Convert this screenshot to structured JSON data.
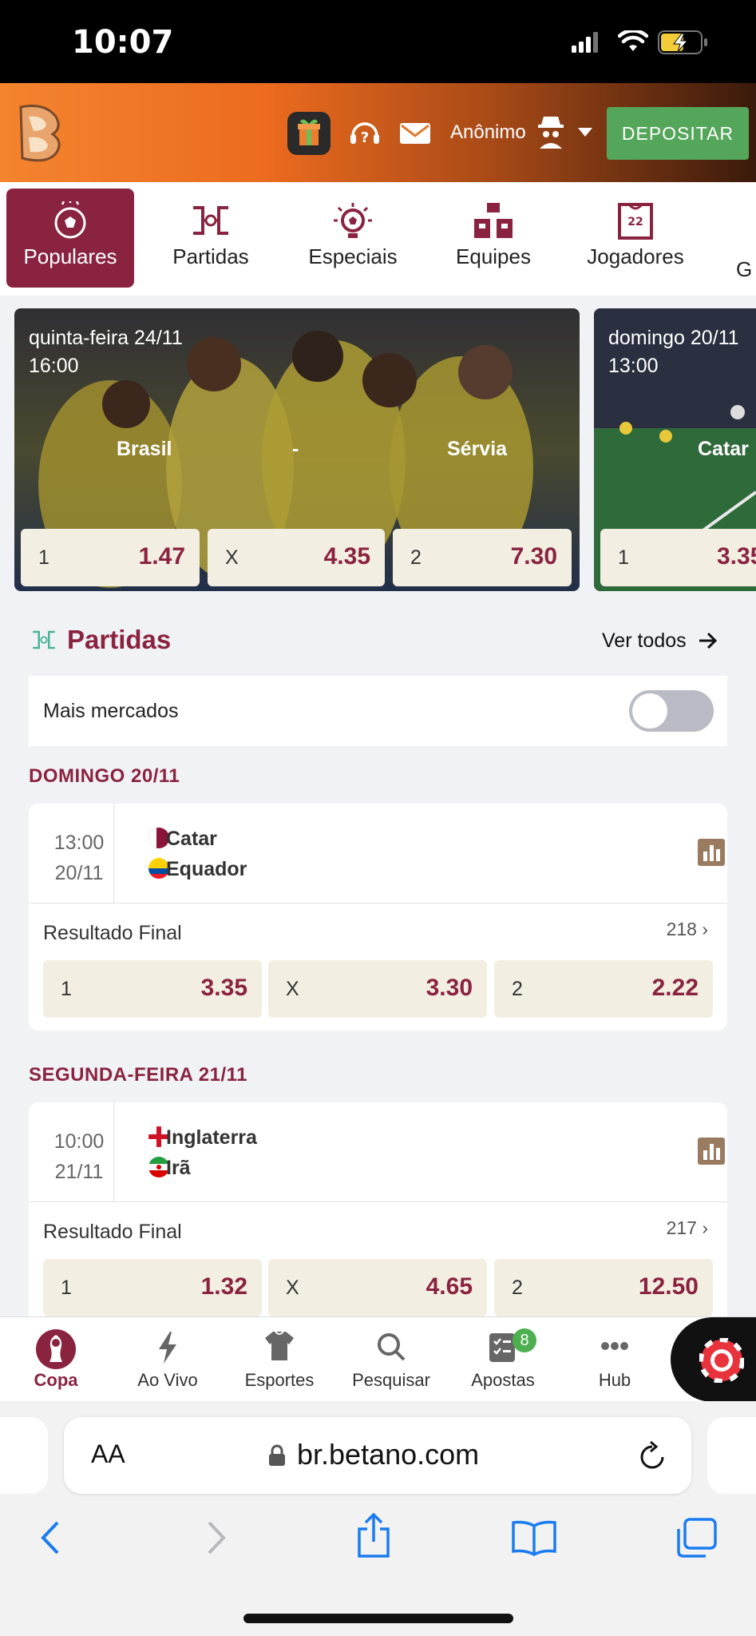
{
  "status_bar": {
    "time": "10:07"
  },
  "header": {
    "user_label": "Anônimo",
    "deposit_label": "DEPOSITAR"
  },
  "tabs": [
    {
      "label": "Populares",
      "icon": "soccer-ball-icon",
      "active": true
    },
    {
      "label": "Partidas",
      "icon": "versus-icon"
    },
    {
      "label": "Especiais",
      "icon": "lightbulb-ball-icon"
    },
    {
      "label": "Equipes",
      "icon": "team-shirts-icon"
    },
    {
      "label": "Jogadores",
      "icon": "player-shirt-icon"
    },
    {
      "label": "G"
    }
  ],
  "hero_cards": [
    {
      "date": "quinta-feira 24/11",
      "time": "16:00",
      "home": "Brasil",
      "separator": "-",
      "away": "Sérvia",
      "odds": [
        {
          "label": "1",
          "value": "1.47"
        },
        {
          "label": "X",
          "value": "4.35"
        },
        {
          "label": "2",
          "value": "7.30"
        }
      ]
    },
    {
      "date": "domingo 20/11",
      "time": "13:00",
      "home": "Catar",
      "odds": [
        {
          "label": "1",
          "value": "3.35"
        }
      ]
    }
  ],
  "partidas": {
    "title": "Partidas",
    "see_all": "Ver todos",
    "more_markets_label": "Mais mercados",
    "more_markets_on": false,
    "groups": [
      {
        "date_header": "DOMINGO 20/11",
        "match": {
          "time": "13:00",
          "date": "20/11",
          "home": "Catar",
          "away": "Equador",
          "market": "Resultado Final",
          "market_count": "218",
          "odds": [
            {
              "label": "1",
              "value": "3.35"
            },
            {
              "label": "X",
              "value": "3.30"
            },
            {
              "label": "2",
              "value": "2.22"
            }
          ]
        }
      },
      {
        "date_header": "SEGUNDA-FEIRA 21/11",
        "match": {
          "time": "10:00",
          "date": "21/11",
          "home": "Inglaterra",
          "away": "Irã",
          "market": "Resultado Final",
          "market_count": "217",
          "odds": [
            {
              "label": "1",
              "value": "1.32"
            },
            {
              "label": "X",
              "value": "4.65"
            },
            {
              "label": "2",
              "value": "12.50"
            }
          ]
        }
      }
    ]
  },
  "bottom_nav": [
    {
      "label": "Copa",
      "icon": "world-cup-icon",
      "active": true
    },
    {
      "label": "Ao Vivo",
      "icon": "lightning-icon"
    },
    {
      "label": "Esportes",
      "icon": "shirt-icon"
    },
    {
      "label": "Pesquisar",
      "icon": "search-icon"
    },
    {
      "label": "Apostas",
      "icon": "betslip-icon",
      "badge": "8"
    },
    {
      "label": "Hub",
      "icon": "more-dots-icon"
    }
  ],
  "browser": {
    "text_size": "AA",
    "url": "br.betano.com"
  },
  "colors": {
    "brand": "#8a2340",
    "deposit": "#54a65a",
    "header_orange": "#f4842e",
    "odd_bg": "#f2eee2"
  }
}
